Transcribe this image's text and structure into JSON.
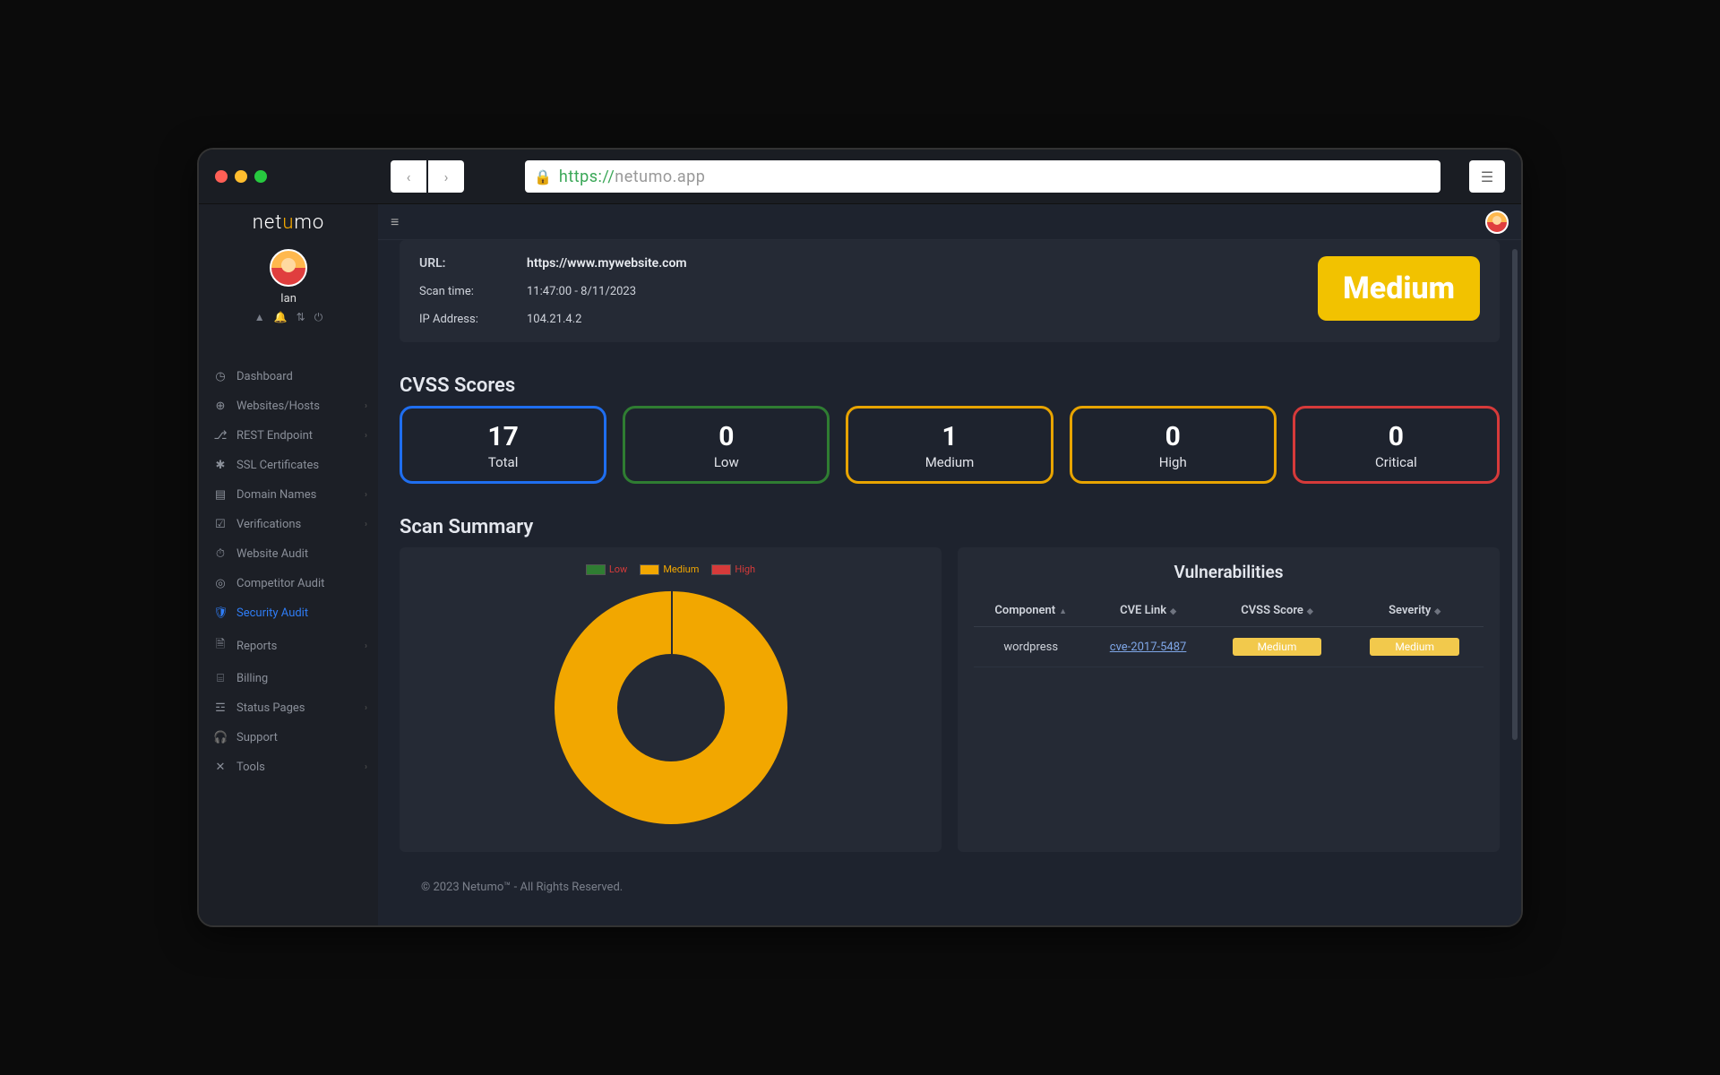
{
  "browser": {
    "url_protocol": "https://",
    "url_host": "netumo.app"
  },
  "logo": "netumo",
  "user": {
    "name": "Ian"
  },
  "sidebar": {
    "items": [
      {
        "label": "Dashboard",
        "icon": "◷",
        "expandable": false
      },
      {
        "label": "Websites/Hosts",
        "icon": "⊕",
        "expandable": true
      },
      {
        "label": "REST Endpoint",
        "icon": "⎇",
        "expandable": true
      },
      {
        "label": "SSL Certificates",
        "icon": "✱",
        "expandable": false
      },
      {
        "label": "Domain Names",
        "icon": "▤",
        "expandable": true
      },
      {
        "label": "Verifications",
        "icon": "☑",
        "expandable": true
      },
      {
        "label": "Website Audit",
        "icon": "⏱",
        "expandable": false
      },
      {
        "label": "Competitor Audit",
        "icon": "◎",
        "expandable": false
      },
      {
        "label": "Security Audit",
        "icon": "🛡",
        "expandable": false,
        "active": true
      },
      {
        "label": "Reports",
        "icon": "🗎",
        "expandable": true
      },
      {
        "label": "Billing",
        "icon": "⌸",
        "expandable": false
      },
      {
        "label": "Status Pages",
        "icon": "☲",
        "expandable": true
      },
      {
        "label": "Support",
        "icon": "🎧",
        "expandable": false
      },
      {
        "label": "Tools",
        "icon": "✕",
        "expandable": true
      }
    ]
  },
  "scan": {
    "url_label": "URL:",
    "url_value": "https://www.mywebsite.com",
    "time_label": "Scan time:",
    "time_value": "11:47:00 - 8/11/2023",
    "ip_label": "IP Address:",
    "ip_value": "104.21.4.2",
    "risk": "Medium"
  },
  "cvss": {
    "title": "CVSS Scores",
    "boxes": [
      {
        "value": "17",
        "label": "Total"
      },
      {
        "value": "0",
        "label": "Low"
      },
      {
        "value": "1",
        "label": "Medium"
      },
      {
        "value": "0",
        "label": "High"
      },
      {
        "value": "0",
        "label": "Critical"
      }
    ]
  },
  "summary_title": "Scan Summary",
  "legend": {
    "low": "Low",
    "medium": "Medium",
    "high": "High"
  },
  "vuln": {
    "title": "Vulnerabilities",
    "cols": {
      "component": "Component",
      "cve": "CVE Link",
      "score": "CVSS Score",
      "severity": "Severity"
    },
    "rows": [
      {
        "component": "wordpress",
        "cve": "cve-2017-5487",
        "score": "Medium",
        "severity": "Medium"
      }
    ]
  },
  "chart_data": {
    "type": "pie",
    "title": "Scan Summary",
    "series": [
      {
        "name": "Low",
        "value": 0,
        "color": "#2f7d32"
      },
      {
        "name": "Medium",
        "value": 1,
        "color": "#f2a700"
      },
      {
        "name": "High",
        "value": 0,
        "color": "#d63a3a"
      }
    ]
  },
  "footer": "© 2023 Netumo™ - All Rights Reserved."
}
